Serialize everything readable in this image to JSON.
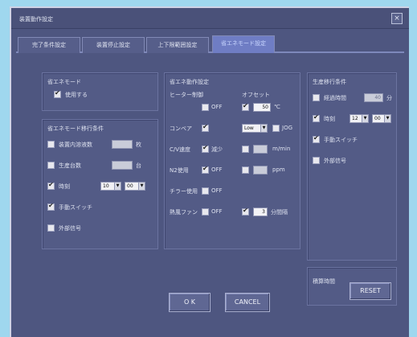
{
  "window": {
    "title": "装置動作設定",
    "close_label": "×"
  },
  "tabs": [
    {
      "label": "完了条件設定"
    },
    {
      "label": "装置停止設定"
    },
    {
      "label": "上下限範囲設定"
    },
    {
      "label": "省エネモード設定"
    }
  ],
  "eco_mode": {
    "heading": "省エネモード",
    "use_label": "使用する"
  },
  "transition": {
    "heading": "省エネモード移行条件",
    "items": [
      {
        "label": "装置内溶液数",
        "value": "",
        "unit": "枚"
      },
      {
        "label": "生産台数",
        "value": "",
        "unit": "台"
      },
      {
        "label": "時刻",
        "hour": "10",
        "minute": "00"
      },
      {
        "label": "手動スイッチ"
      },
      {
        "label": "外部信号"
      }
    ]
  },
  "eco_operation": {
    "heading": "省エネ動作設定",
    "heater_label": "ヒーター制御",
    "offset_label": "オフセット",
    "heater_off": "OFF",
    "offset_value": "50",
    "offset_unit": "℃",
    "conveyor_label": "コンベア",
    "conveyor_select": "Low",
    "jog_label": "JOG",
    "cv_speed_label": "C/V速度",
    "cv_speed_reduce": "減少",
    "cv_speed_unit": "m/min",
    "n2_label": "N2使用",
    "n2_off": "OFF",
    "n2_unit": "ppm",
    "chiller_label": "チラー使用",
    "chiller_off": "OFF",
    "fan_label": "熱風ファン",
    "fan_off": "OFF",
    "fan_value": "3",
    "fan_unit": "分間隔"
  },
  "recovery": {
    "heading": "生産移行条件",
    "items": [
      {
        "label": "経過時間",
        "value": "40",
        "unit": "分"
      },
      {
        "label": "時刻",
        "hour": "12",
        "minute": "00"
      },
      {
        "label": "手動スイッチ"
      },
      {
        "label": "外部信号"
      }
    ]
  },
  "accum": {
    "label": "積算時間",
    "reset": "RESET"
  },
  "footer": {
    "ok": "O K",
    "cancel": "CANCEL"
  }
}
